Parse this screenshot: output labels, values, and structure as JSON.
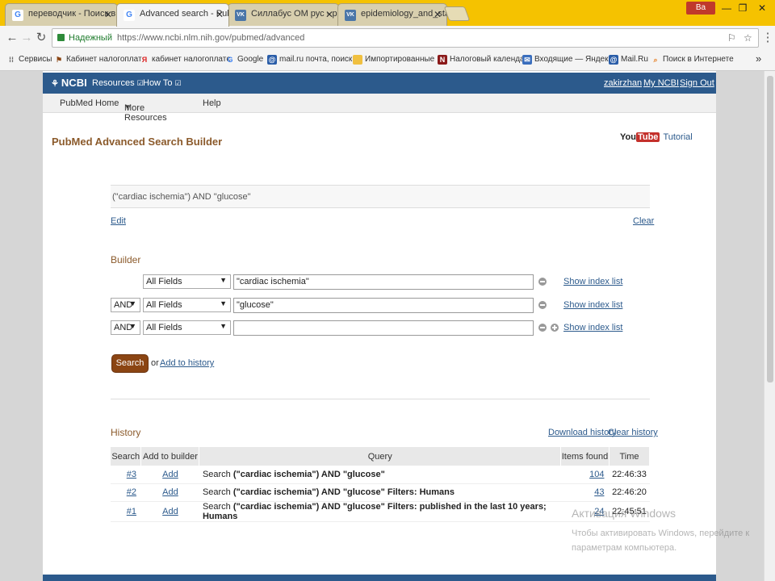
{
  "browser": {
    "tabs": [
      {
        "label": "переводчик - Поиск в G",
        "favicon": "G",
        "color": "#4285f4"
      },
      {
        "label": "Advanced search - PubM",
        "favicon": "G",
        "color": "#4285f4"
      },
      {
        "label": "Силлабус ОМ рус - рабо",
        "favicon": "VK",
        "color": "#4a76a8"
      },
      {
        "label": "epidemiology_and_statis",
        "favicon": "VK",
        "color": "#4a76a8"
      }
    ],
    "profile": "Ва",
    "secure_label": "Надежный",
    "url": "https://www.ncbi.nlm.nih.gov/pubmed/advanced",
    "bookmarks": [
      {
        "label": "Сервисы",
        "icon": "apps-icon"
      },
      {
        "label": "Кабинет налогоплат",
        "icon": "K"
      },
      {
        "label": "кабинет налогоплатє",
        "icon": "Я"
      },
      {
        "label": "Google",
        "icon": "G"
      },
      {
        "label": "mail.ru почта, поиск",
        "icon": "@"
      },
      {
        "label": "Импортированные",
        "icon": "folder-icon"
      },
      {
        "label": "Налоговый календар",
        "icon": "N"
      },
      {
        "label": "Входящие — Яндекс",
        "icon": "M"
      },
      {
        "label": "Mail.Ru",
        "icon": "@"
      },
      {
        "label": "Поиск в Интернете",
        "icon": "search-icon"
      }
    ],
    "bookmarks_more": "»"
  },
  "ncbi": {
    "logo": "NCBI",
    "resources": "Resources",
    "howto": "How To",
    "user": "zakirzhan",
    "my_ncbi": "My NCBI",
    "sign_out": "Sign Out",
    "subnav": [
      "PubMed Home",
      "More Resources",
      "Help"
    ]
  },
  "page": {
    "title": "PubMed Advanced Search Builder",
    "youtube_you": "You",
    "youtube_tube": "Tube",
    "tutorial": "Tutorial",
    "query": "(\"cardiac ischemia\") AND \"glucose\"",
    "edit": "Edit",
    "clear": "Clear",
    "builder_label": "Builder",
    "rows": [
      {
        "op": "",
        "field": "All Fields",
        "term": "\"cardiac ischemia\"",
        "index": "Show index list"
      },
      {
        "op": "AND",
        "field": "All Fields",
        "term": "\"glucose\"",
        "index": "Show index list"
      },
      {
        "op": "AND",
        "field": "All Fields",
        "term": "",
        "index": "Show index list"
      }
    ],
    "search_btn": "Search",
    "or_text": "or",
    "add_history": "Add to history",
    "history_label": "History",
    "download_history": "Download history",
    "clear_history": "Clear history",
    "table_headers": [
      "Search",
      "Add to builder",
      "Query",
      "Items found",
      "Time"
    ],
    "history": [
      {
        "num": "#3",
        "add": "Add",
        "query_prefix": "Search ",
        "query_bold": "(\"cardiac ischemia\") AND \"glucose\"",
        "filters": "",
        "items": "104",
        "time": "22:46:33"
      },
      {
        "num": "#2",
        "add": "Add",
        "query_prefix": "Search ",
        "query_bold": "(\"cardiac ischemia\") AND \"glucose\"",
        "filters": " Filters: Humans",
        "items": "43",
        "time": "22:46:20"
      },
      {
        "num": "#1",
        "add": "Add",
        "query_prefix": "Search ",
        "query_bold": "(\"cardiac ischemia\") AND \"glucose\"",
        "filters": " Filters: published in the last 10 years; Humans",
        "items": "24",
        "time": "22:45:51"
      }
    ]
  },
  "watermark": {
    "line1": "Активация Windows",
    "line2": "Чтобы активировать Windows, перейдите к параметрам компьютера."
  }
}
